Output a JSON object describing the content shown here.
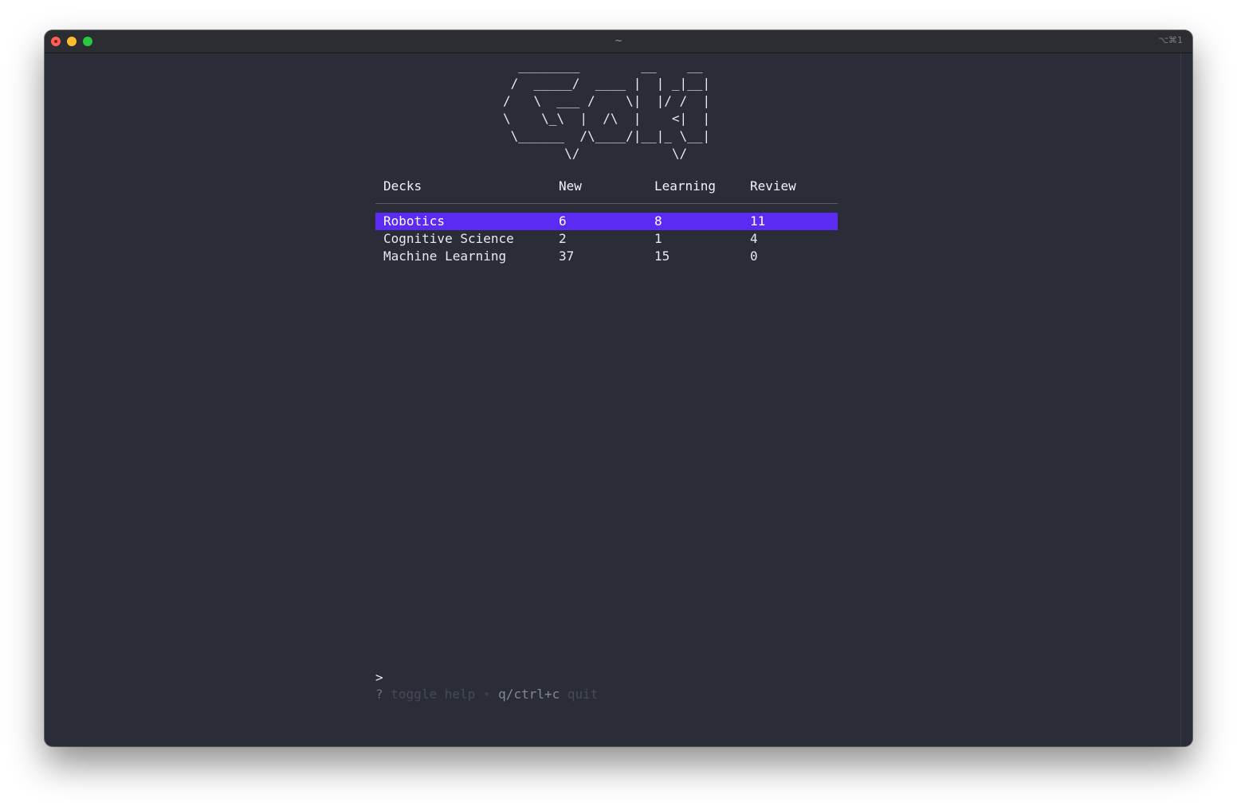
{
  "window": {
    "title": "~",
    "shortcut": "⌥⌘1"
  },
  "logo_ascii": "  ________        __    __\n /  _____/  ____ |  | _|__|\n/   \\  ___ /    \\|  |/ /  |\n\\    \\_\\  |  /\\  |    <|  |\n \\______  /\\____/|__|_ \\__|\n        \\/            \\/",
  "table": {
    "headers": [
      "Decks",
      "New",
      "Learning",
      "Review"
    ],
    "rows": [
      {
        "deck": "Robotics",
        "new": "6",
        "learning": "8",
        "review": "11",
        "selected": true
      },
      {
        "deck": "Cognitive Science",
        "new": "2",
        "learning": "1",
        "review": "4",
        "selected": false
      },
      {
        "deck": "Machine Learning",
        "new": "37",
        "learning": "15",
        "review": "0",
        "selected": false
      }
    ]
  },
  "prompt": {
    "symbol": ">"
  },
  "help": {
    "toggle_key": "?",
    "toggle_label": "toggle help",
    "separator": "•",
    "quit_key": "q/ctrl+c",
    "quit_label": "quit"
  },
  "colors": {
    "terminal_bg": "#2a2d38",
    "selection": "#5b2bf4",
    "text": "#e9e9ee",
    "help_dim": "#474a56"
  }
}
